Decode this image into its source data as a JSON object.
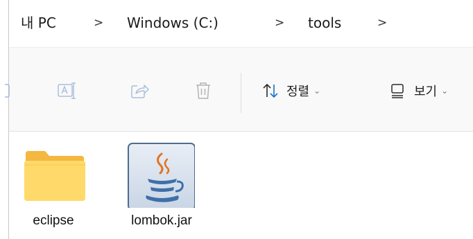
{
  "breadcrumb": {
    "items": [
      "내 PC",
      "Windows (C:)",
      "tools"
    ],
    "separator": ">"
  },
  "toolbar": {
    "sort_label": "정렬",
    "view_label": "보기",
    "caret": "⌄"
  },
  "files": [
    {
      "name": "eclipse",
      "type": "folder",
      "icon": "folder-icon"
    },
    {
      "name": "lombok.jar",
      "type": "java-archive",
      "icon": "java-jar-icon"
    }
  ],
  "colors": {
    "folder_front": "#ffd96a",
    "folder_back": "#f4b73f",
    "java_blue": "#3f6fa8",
    "java_red": "#e2731f",
    "sort_arrow_blue": "#1a6fd0"
  }
}
